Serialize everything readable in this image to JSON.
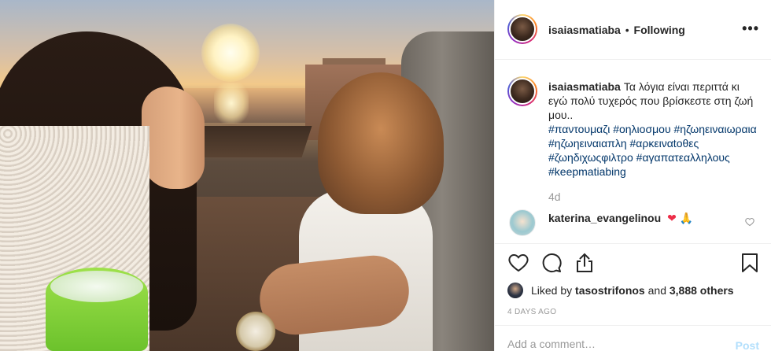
{
  "post": {
    "username": "isaiasmatiaba",
    "separator": "•",
    "follow_status": "Following",
    "more_label": "•••"
  },
  "caption": {
    "username": "isaiasmatiaba",
    "text": "Τα λόγια είναι περιττά κι εγώ πολύ τυχερός που βρίσκεστε στη ζωή μου..",
    "hashtags": "#παντουμαζι #οηλιοσμου #ηζωηειναιωραια #ηζωηειναιαπλη #αρκειναtοθες #ζωηδιχωςφιλτρο #αγαπατεαλληλους #keepmatiabing",
    "time": "4d"
  },
  "comment": {
    "username": "katerina_evangelinou",
    "emoji_heart": "❤",
    "emoji_pray": "🙏"
  },
  "likes": {
    "prefix": "Liked by",
    "user": "tasostrifonos",
    "middle": "and",
    "count": "3,888 others"
  },
  "date": "4 DAYS AGO",
  "add_comment": {
    "placeholder": "Add a comment…",
    "post_label": "Post"
  },
  "icons": {
    "like": "heart-outline-icon",
    "comment": "speech-bubble-icon",
    "share": "share-upload-icon",
    "save": "bookmark-icon",
    "comment_like": "small-heart-icon"
  },
  "colors": {
    "hashtag": "#003569",
    "secondary_text": "#999999",
    "post_button": "#b2dffc",
    "border": "#efefef"
  }
}
